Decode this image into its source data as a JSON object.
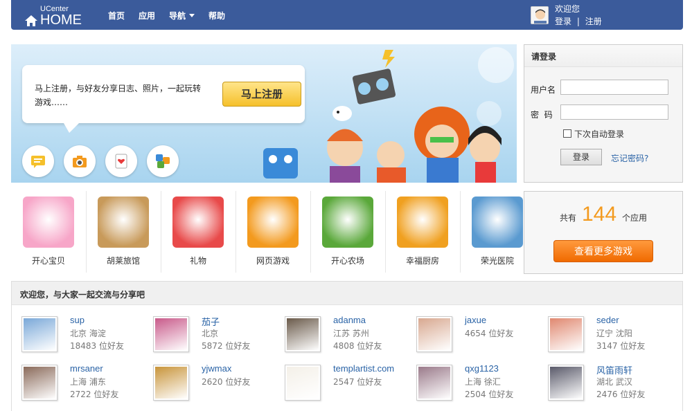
{
  "header": {
    "logo_small": "UCenter",
    "logo_main": "HOME",
    "nav": [
      "首页",
      "应用",
      "导航",
      "帮助"
    ],
    "welcome": "欢迎您",
    "login_link": "登录",
    "separator": "|",
    "register_link": "注册"
  },
  "banner": {
    "text": "马上注册，与好友分享日志、照片，一起玩转游戏……",
    "register_button": "马上注册",
    "icons": [
      "message-icon",
      "camera-icon",
      "card-icon",
      "apps-icon"
    ]
  },
  "login": {
    "title": "请登录",
    "username_label": "用户名",
    "password_label": "密  码",
    "remember_label": "下次自动登录",
    "submit": "登录",
    "forgot": "忘记密码?"
  },
  "apps": [
    {
      "name": "开心宝贝",
      "color": "#f7a6c8"
    },
    {
      "name": "胡莱旅馆",
      "color": "#c89a5a"
    },
    {
      "name": "礼物",
      "color": "#e84a4a"
    },
    {
      "name": "网页游戏",
      "color": "#f39a1e"
    },
    {
      "name": "开心农场",
      "color": "#5aa83a"
    },
    {
      "name": "幸福厨房",
      "color": "#f0a020"
    },
    {
      "name": "荣光医院",
      "color": "#5a9ad0"
    }
  ],
  "app_count": {
    "prefix": "共有",
    "number": "144",
    "suffix": "个应用",
    "more_button": "查看更多游戏"
  },
  "friends": {
    "title": "欢迎您，与大家一起交流与分享吧",
    "items": [
      {
        "name": "sup",
        "location": "北京 海淀",
        "count": "18483 位好友",
        "color": "#7aa8d8"
      },
      {
        "name": "茄子",
        "location": "北京",
        "count": "5872 位好友",
        "color": "#c85a8a"
      },
      {
        "name": "adanma",
        "location": "江苏 苏州",
        "count": "4808 位好友",
        "color": "#6a5a4a"
      },
      {
        "name": "jaxue",
        "location": "",
        "count": "4654 位好友",
        "color": "#d8a890"
      },
      {
        "name": "seder",
        "location": "辽宁 沈阳",
        "count": "3147 位好友",
        "color": "#e08870"
      },
      {
        "name": "mrsaner",
        "location": "上海 浦东",
        "count": "2722 位好友",
        "color": "#8a6a5a"
      },
      {
        "name": "yjwmax",
        "location": "",
        "count": "2620 位好友",
        "color": "#c8943a"
      },
      {
        "name": "templartist.com",
        "location": "",
        "count": "2547 位好友",
        "color": "#f4f0e8"
      },
      {
        "name": "qxg1123",
        "location": "上海 徐汇",
        "count": "2504 位好友",
        "color": "#9a7a8a"
      },
      {
        "name": "风笛雨轩",
        "location": "湖北 武汉",
        "count": "2476 位好友",
        "color": "#5a5a6a"
      }
    ]
  }
}
